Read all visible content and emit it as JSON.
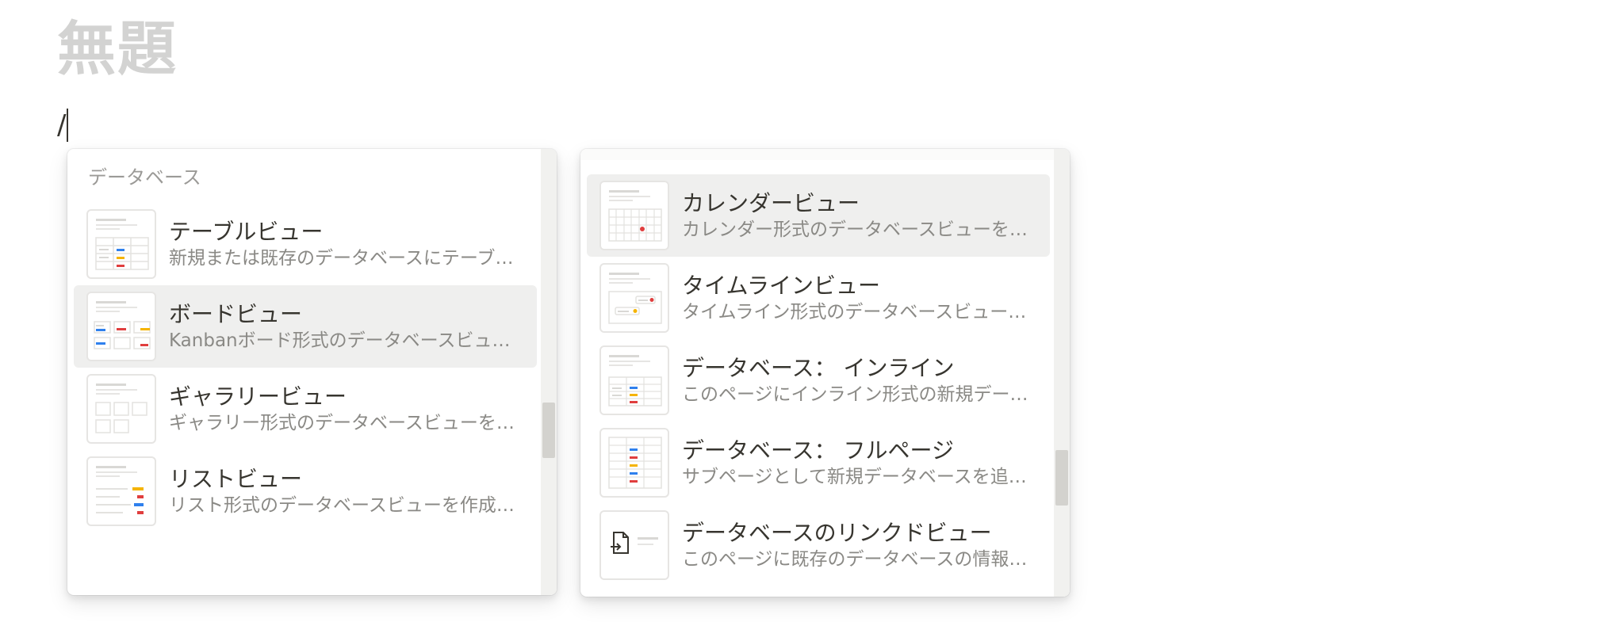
{
  "page": {
    "title": "無題",
    "slash": "/"
  },
  "left_menu": {
    "section_header": "データベース",
    "items": [
      {
        "title": "テーブルビュー",
        "desc": "新規または既存のデータベースにテーブ…",
        "icon": "table-view-thumbnail"
      },
      {
        "title": "ボードビュー",
        "desc": "Kanbanボード形式のデータベースビュ…",
        "icon": "board-view-thumbnail",
        "selected": true
      },
      {
        "title": "ギャラリービュー",
        "desc": "ギャラリー形式のデータベースビューを…",
        "icon": "gallery-view-thumbnail"
      },
      {
        "title": "リストビュー",
        "desc": "リスト形式のデータベースビューを作成…",
        "icon": "list-view-thumbnail"
      }
    ]
  },
  "right_menu": {
    "items": [
      {
        "title": "カレンダービュー",
        "desc": "カレンダー形式のデータベースビューを…",
        "icon": "calendar-view-thumbnail",
        "selected": true
      },
      {
        "title": "タイムラインビュー",
        "desc": "タイムライン形式のデータベースビュー…",
        "icon": "timeline-view-thumbnail"
      },
      {
        "title": "データベース： インライン",
        "desc": "このページにインライン形式の新規デー…",
        "icon": "database-inline-thumbnail"
      },
      {
        "title": "データベース： フルページ",
        "desc": "サブページとして新規データベースを追…",
        "icon": "database-fullpage-thumbnail"
      },
      {
        "title": "データベースのリンクドビュー",
        "desc": "このページに既存のデータベースの情報…",
        "icon": "linked-database-thumbnail"
      }
    ]
  },
  "colors": {
    "blue": "#2f80ed",
    "red": "#e03e3e",
    "yellow": "#f5b400",
    "selected_bg": "#efefee",
    "title_placeholder": "#d3d3d2"
  }
}
